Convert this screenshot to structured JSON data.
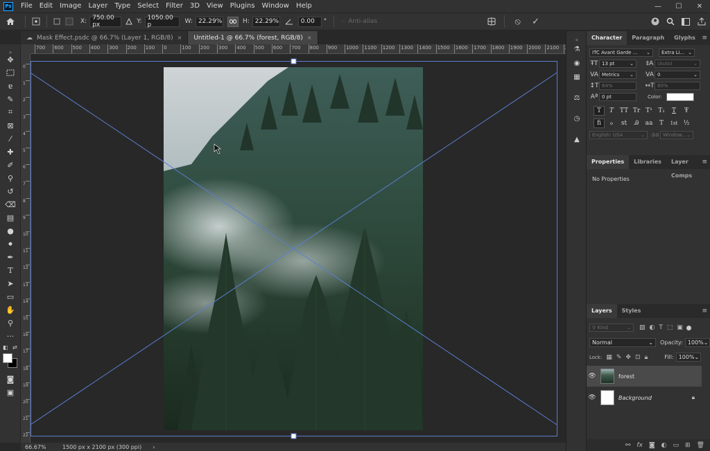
{
  "app_logo": "Ps",
  "menu": [
    "File",
    "Edit",
    "Image",
    "Layer",
    "Type",
    "Select",
    "Filter",
    "3D",
    "View",
    "Plugins",
    "Window",
    "Help"
  ],
  "window_controls": {
    "minimize": "—",
    "maximize": "☐",
    "close": "✕"
  },
  "options": {
    "x_label": "X:",
    "x_value": "750.00 px",
    "y_label": "Y:",
    "y_value": "1050.00 p",
    "w_label": "W:",
    "w_value": "22.29%",
    "h_label": "H:",
    "h_value": "22.29%",
    "angle_value": "0.00",
    "angle_unit": "°",
    "antialias_label": "Anti-alias",
    "cancel_icon": "⦸",
    "commit_icon": "✓"
  },
  "tabs": [
    {
      "label": "Mask Effect.psdc @ 66.7% (Layer 1, RGB/8)",
      "close": "×"
    },
    {
      "label": "Untitled-1 @ 66.7% (forest, RGB/8)",
      "close": "×"
    }
  ],
  "ruler_top": [
    "700",
    "600",
    "500",
    "400",
    "300",
    "200",
    "100",
    "0",
    "100",
    "200",
    "300",
    "400",
    "500",
    "600",
    "700",
    "800",
    "900",
    "1000",
    "1100",
    "1200",
    "1300",
    "1400",
    "1500",
    "1600",
    "1700",
    "1800",
    "1900",
    "2000",
    "2100",
    "2200"
  ],
  "ruler_left": [
    "0",
    "1",
    "2",
    "3",
    "4",
    "5",
    "6",
    "7",
    "8",
    "9",
    "10",
    "11",
    "12",
    "13",
    "14",
    "15",
    "16",
    "17",
    "18",
    "19",
    "20",
    "21",
    "22"
  ],
  "status": {
    "zoom": "66.67%",
    "doc_info": "1500 px x 2100 px (300 ppi)",
    "arrow": "›"
  },
  "character_panel": {
    "tabs": [
      "Character",
      "Paragraph",
      "Glyphs"
    ],
    "font_family": "ITC Avant Garde ...",
    "font_style": "Extra Li...",
    "size": "13 pt",
    "leading": "(Auto)",
    "kerning": "Metrics",
    "tracking": "0",
    "vscale": "64%",
    "hscale": "80%",
    "baseline": "0 pt",
    "color_label": "Color:",
    "styles": [
      "T",
      "T",
      "TT",
      "Tr",
      "T¹",
      "T₁",
      "T",
      "Ŧ"
    ],
    "opentype": [
      "fi",
      "ℴ",
      "st",
      "Ꭿ",
      "aa",
      "T",
      "1st",
      "½"
    ],
    "language": "English: USA",
    "aa_mode": "Window..."
  },
  "properties_panel": {
    "tabs": [
      "Properties",
      "Libraries",
      "Layer Comps"
    ],
    "content": "No Properties"
  },
  "layers_panel": {
    "tabs": [
      "Layers",
      "Styles"
    ],
    "filter_placeholder": "Kind",
    "blend_mode": "Normal",
    "opacity_label": "Opacity:",
    "opacity_value": "100%",
    "lock_label": "Lock:",
    "fill_label": "Fill:",
    "fill_value": "100%",
    "layers": [
      {
        "name": "forest",
        "selected": true
      },
      {
        "name": "Background",
        "selected": false,
        "locked": true
      }
    ]
  }
}
